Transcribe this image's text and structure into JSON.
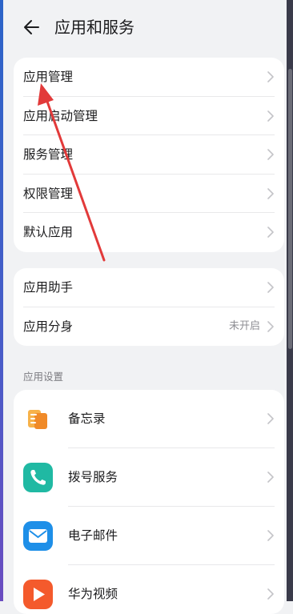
{
  "header": {
    "title": "应用和服务",
    "back_icon": "arrow-left-icon"
  },
  "card1": {
    "items": [
      {
        "label": "应用管理"
      },
      {
        "label": "应用启动管理"
      },
      {
        "label": "服务管理"
      },
      {
        "label": "权限管理"
      },
      {
        "label": "默认应用"
      }
    ]
  },
  "card2": {
    "items": [
      {
        "label": "应用助手"
      },
      {
        "label": "应用分身",
        "value": "未开启"
      }
    ]
  },
  "app_settings": {
    "section_title": "应用设置",
    "apps": [
      {
        "label": "备忘录",
        "icon": "notepad-icon",
        "color": "#f08a28"
      },
      {
        "label": "拨号服务",
        "icon": "phone-icon",
        "color": "#20b9a3"
      },
      {
        "label": "电子邮件",
        "icon": "mail-icon",
        "color": "#1e8fe8"
      },
      {
        "label": "华为视频",
        "icon": "video-play-icon",
        "color": "#f45a2c"
      }
    ]
  },
  "annotation": {
    "color": "#e23a3a",
    "icon": "red-pointer-arrow-icon"
  }
}
